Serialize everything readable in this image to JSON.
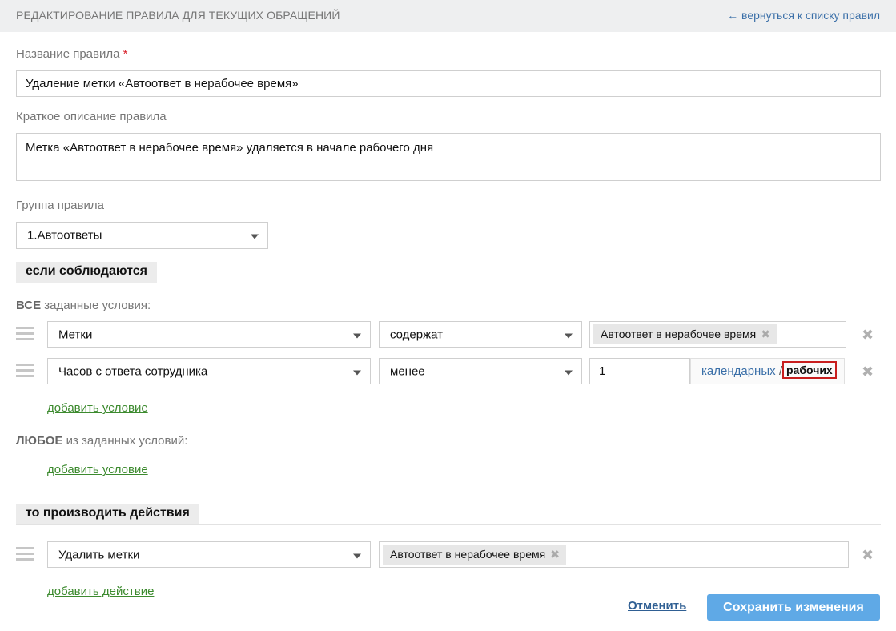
{
  "header": {
    "title": "РЕДАКТИРОВАНИЕ ПРАВИЛА ДЛЯ ТЕКУЩИХ ОБРАЩЕНИЙ",
    "back_link": "← вернуться к списку правил"
  },
  "form": {
    "name_label": "Название правила",
    "name_required_mark": "*",
    "name_value": "Удаление метки «Автоответ в нерабочее время»",
    "desc_label": "Краткое описание правила",
    "desc_value": "Метка «Автоответ в нерабочее время» удаляется в начале рабочего дня",
    "group_label": "Группа правила",
    "group_value": "1.Автоответы"
  },
  "conditions": {
    "section_title": "если соблюдаются",
    "all_prefix": "ВСЕ",
    "all_suffix": " заданные условия:",
    "rows": [
      {
        "field": "Метки",
        "operator": "содержат",
        "tag": "Автоответ в нерабочее время"
      },
      {
        "field": "Часов с ответа сотрудника",
        "operator": "менее",
        "value": "1",
        "unit_calendar": "календарных",
        "unit_separator": "/",
        "unit_working": "рабочих"
      }
    ],
    "add_condition_all": "добавить условие",
    "any_prefix": "ЛЮБОЕ",
    "any_suffix": " из заданных условий:",
    "add_condition_any": "добавить условие"
  },
  "actions": {
    "section_title": "то производить действия",
    "rows": [
      {
        "action": "Удалить метки",
        "tag": "Автоответ в нерабочее время"
      }
    ],
    "add_action": "добавить действие"
  },
  "footer": {
    "cancel": "Отменить",
    "save": "Сохранить изменения"
  },
  "icons": {
    "remove": "✖",
    "tag_remove": "✖"
  },
  "colors": {
    "link_blue": "#3a6fa8",
    "link_green": "#3c8a2e",
    "save_button": "#5fa9e6",
    "required": "#d9232d",
    "highlight_border": "#c81e1e"
  }
}
